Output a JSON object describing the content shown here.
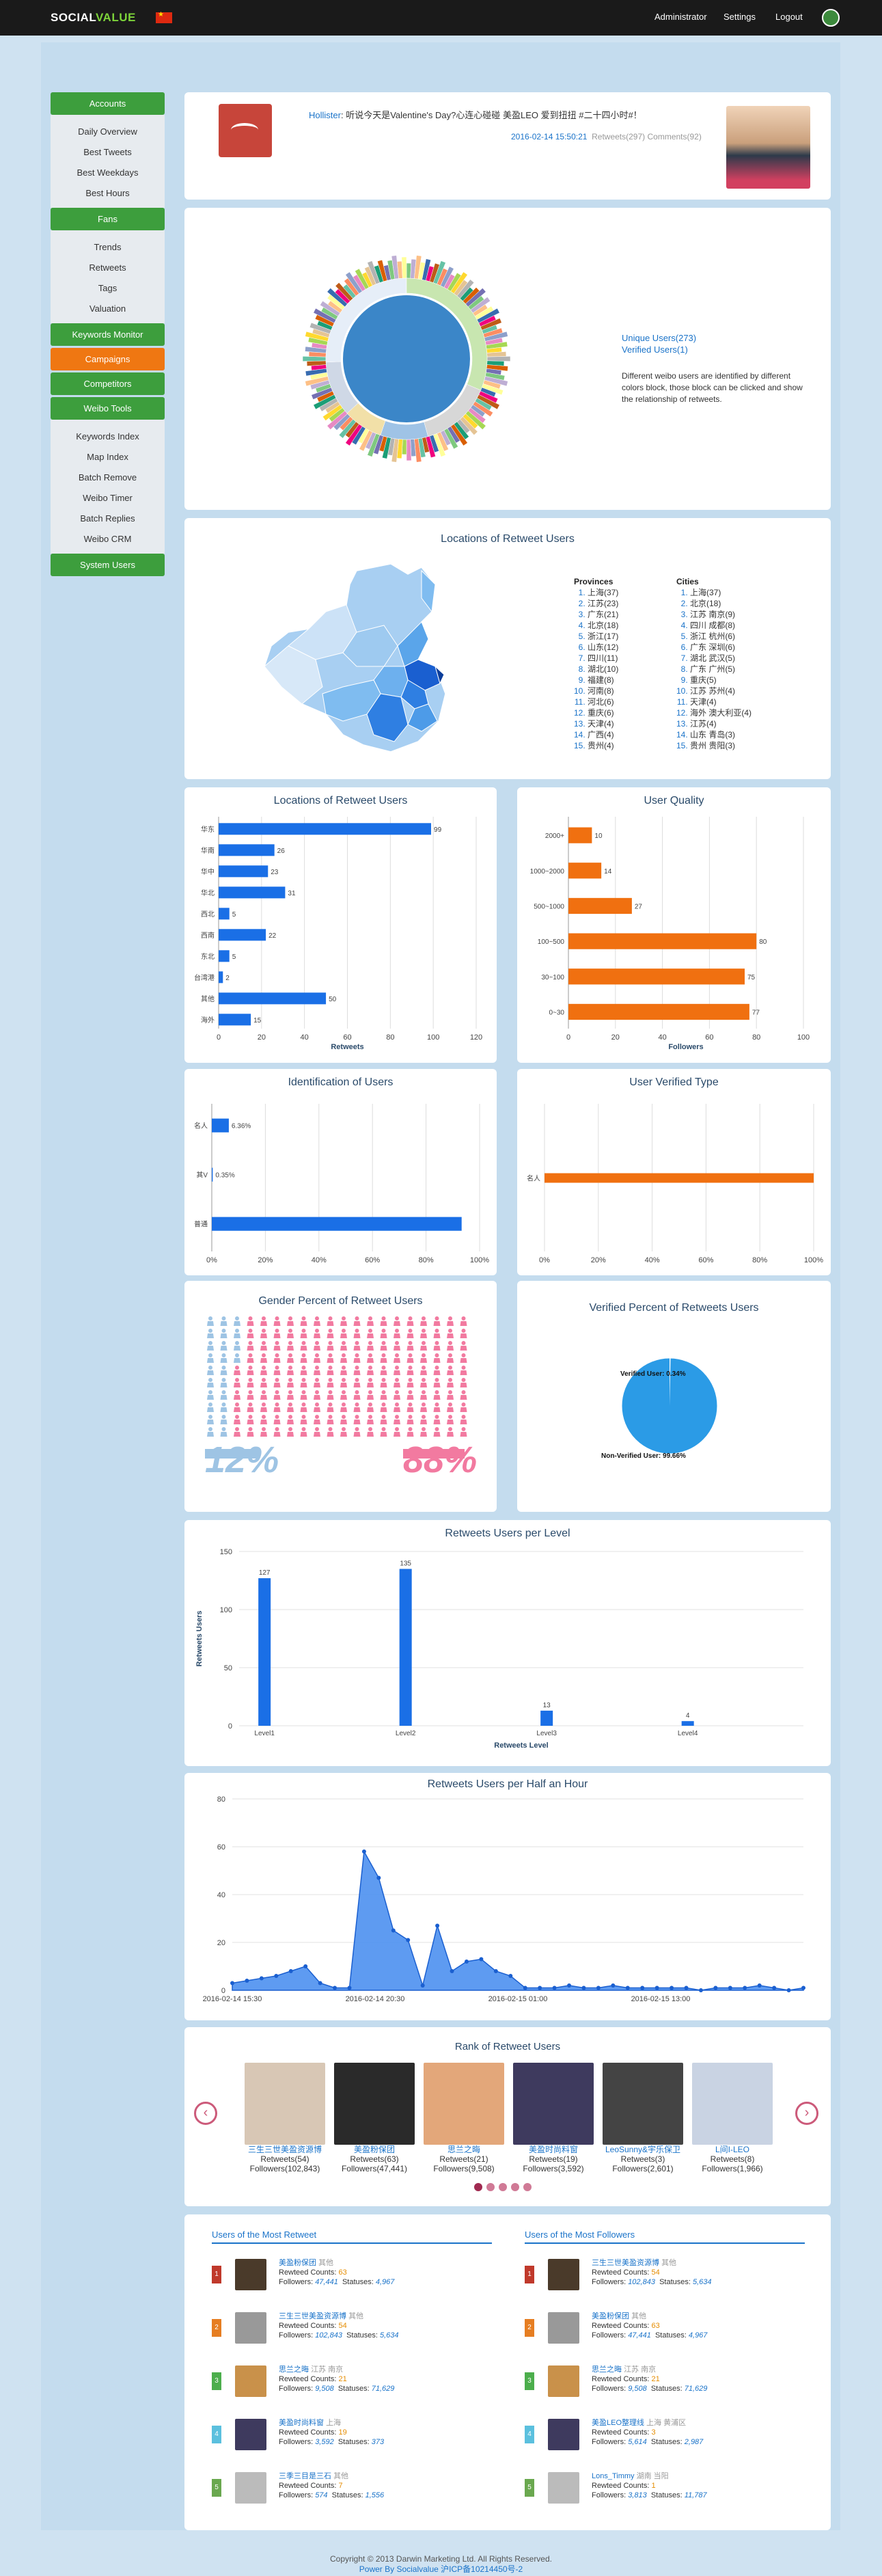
{
  "brand": {
    "left": "SOCIAL",
    "right": "VALUE"
  },
  "topnav": [
    "Administrator",
    "Settings",
    "Logout"
  ],
  "sidebar": {
    "accounts": "Accounts",
    "accounts_items": [
      "Daily Overview",
      "Best Tweets",
      "Best Weekdays",
      "Best Hours"
    ],
    "fans": "Fans",
    "fans_items": [
      "Trends",
      "Retweets",
      "Tags",
      "Valuation"
    ],
    "keywords": "Keywords Monitor",
    "campaigns": "Campaigns",
    "competitors": "Competitors",
    "weibo": "Weibo Tools",
    "weibo_items": [
      "Keywords Index",
      "Map Index",
      "Batch Remove",
      "Weibo Timer",
      "Batch Replies",
      "Weibo CRM"
    ],
    "system": "System Users"
  },
  "tweet": {
    "author": "Hollister",
    "text": ": 听说今天是Valentine's Day?心连心碰碰 美盈LEO 爱到扭扭 #二十四小时#！",
    "time": "2016-02-14 15:50:21",
    "retweets": "Retweets(297)",
    "comments": "Comments(92)"
  },
  "network": {
    "unique": "Unique Users(273)",
    "verified": "Verified Users(1)",
    "desc": "Different weibo users are identified by different colors block, those block can be clicked and show the relationship of retweets."
  },
  "map": {
    "title": "Locations of Retweet Users",
    "prov_h": "Provinces",
    "city_h": "Cities",
    "provinces": [
      "上海(37)",
      "江苏(23)",
      "广东(21)",
      "北京(18)",
      "浙江(17)",
      "山东(12)",
      "四川(11)",
      "湖北(10)",
      "福建(8)",
      "河南(8)",
      "河北(6)",
      "重庆(6)",
      "天津(4)",
      "广西(4)",
      "贵州(4)"
    ],
    "cities": [
      "上海(37)",
      "北京(18)",
      "江苏 南京(9)",
      "四川 成都(8)",
      "浙江 杭州(6)",
      "广东 深圳(6)",
      "湖北 武汉(5)",
      "广东 广州(5)",
      "重庆(5)",
      "江苏 苏州(4)",
      "天津(4)",
      "海外 澳大利亚(4)",
      "江苏(4)",
      "山东 青岛(3)",
      "贵州 贵阳(3)"
    ]
  },
  "loc_chart": {
    "title": "Locations of Retweet Users",
    "xlabel": "Retweets"
  },
  "quality_chart": {
    "title": "User Quality",
    "xlabel": "Followers"
  },
  "ident_chart": {
    "title": "Identification of Users"
  },
  "vtype_chart": {
    "title": "User Verified Type"
  },
  "gender": {
    "title": "Gender Percent of Retweet Users",
    "male": "12%",
    "female": "88%"
  },
  "verified_pct": {
    "title": "Verified Percent of Retweets Users"
  },
  "level_chart": {
    "title": "Retweets Users per Level",
    "xlabel": "Retweets Level",
    "ylabel": "Retweets Users"
  },
  "half_chart": {
    "title": "Retweets Users per Half an Hour",
    "ylabel": "Retweets Users"
  },
  "rank": {
    "title": "Rank of Retweet Users",
    "prev": "‹",
    "next": "›",
    "users": [
      {
        "name": "三生三世美盈资源博",
        "r": "Retweets(54)",
        "f": "Followers(102,843)"
      },
      {
        "name": "美盈粉保团",
        "r": "Retweets(63)",
        "f": "Followers(47,441)"
      },
      {
        "name": "思兰之晦",
        "r": "Retweets(21)",
        "f": "Followers(9,508)"
      },
      {
        "name": "美盈时尚料窗",
        "r": "Retweets(19)",
        "f": "Followers(3,592)"
      },
      {
        "name": "LeoSunny&宇乐保卫",
        "r": "Retweets(3)",
        "f": "Followers(2,601)"
      },
      {
        "name": "L间I-LEO",
        "r": "Retweets(8)",
        "f": "Followers(1,966)"
      }
    ]
  },
  "most_retweet": {
    "title": "Users of the Most Retweet",
    "rows": [
      {
        "rank": "1",
        "name": "美盈粉保团",
        "loc": "其他",
        "rc": "63",
        "fol": "47,441",
        "st": "4,967"
      },
      {
        "rank": "2",
        "name": "三生三世美盈资源博",
        "loc": "其他",
        "rc": "54",
        "fol": "102,843",
        "st": "5,634"
      },
      {
        "rank": "3",
        "name": "思兰之晦",
        "loc": "江苏 南京",
        "rc": "21",
        "fol": "9,508",
        "st": "71,629"
      },
      {
        "rank": "4",
        "name": "美盈时尚料窗",
        "loc": "上海",
        "rc": "19",
        "fol": "3,592",
        "st": "373"
      },
      {
        "rank": "5",
        "name": "三季三目是三石",
        "loc": "其他",
        "rc": "7",
        "fol": "574",
        "st": "1,556"
      }
    ]
  },
  "most_followers": {
    "title": "Users of the Most Followers",
    "rows": [
      {
        "rank": "1",
        "name": "三生三世美盈资源博",
        "loc": "其他",
        "rc": "54",
        "fol": "102,843",
        "st": "5,634"
      },
      {
        "rank": "2",
        "name": "美盈粉保团",
        "loc": "其他",
        "rc": "63",
        "fol": "47,441",
        "st": "4,967"
      },
      {
        "rank": "3",
        "name": "思兰之晦",
        "loc": "江苏 南京",
        "rc": "21",
        "fol": "9,508",
        "st": "71,629"
      },
      {
        "rank": "4",
        "name": "美盈LEO整理线",
        "loc": "上海 黄浦区",
        "rc": "3",
        "fol": "5,614",
        "st": "2,987"
      },
      {
        "rank": "5",
        "name": "Lons_Timmy",
        "loc": "湖南 当阳",
        "rc": "1",
        "fol": "3,813",
        "st": "11,787"
      }
    ]
  },
  "labels": {
    "rc": "Rewteed Counts:",
    "fol": "Followers:",
    "st": "Statuses:"
  },
  "footer": {
    "line1": "Copyright © 2013 Darwin Marketing Ltd. All Rights Reserved.",
    "line2": "Power By Socialvalue 沪ICP备10214450号-2"
  },
  "chart_data": [
    {
      "type": "bar",
      "title": "Locations of Retweet Users",
      "xlabel": "Retweets",
      "categories": [
        "华东",
        "华南",
        "华中",
        "华北",
        "西北",
        "西南",
        "东北",
        "台湾港",
        "其他",
        "海外"
      ],
      "values": [
        99,
        26,
        23,
        31,
        5,
        22,
        5,
        2,
        50,
        15
      ],
      "xlim": [
        0,
        120
      ],
      "color": "#1a6fe6"
    },
    {
      "type": "bar",
      "title": "User Quality",
      "xlabel": "Followers",
      "categories": [
        "2000+",
        "1000~2000",
        "500~1000",
        "100~500",
        "30~100",
        "0~30"
      ],
      "values": [
        10,
        14,
        27,
        80,
        75,
        77
      ],
      "xlim": [
        0,
        100
      ],
      "color": "#f07010"
    },
    {
      "type": "bar",
      "title": "Identification of Users",
      "categories": [
        "名人",
        "其V",
        "普通"
      ],
      "values": [
        6.36,
        0.35,
        93.29
      ],
      "labels": [
        "6.36%",
        "0.35%",
        ""
      ],
      "xlim": [
        0,
        100
      ],
      "unit": "%",
      "color": "#1a6fe6"
    },
    {
      "type": "bar",
      "title": "User Verified Type",
      "categories": [
        "名人"
      ],
      "values": [
        100
      ],
      "xlim": [
        0,
        100
      ],
      "unit": "%",
      "color": "#f07010"
    },
    {
      "type": "pie",
      "title": "Verified Percent of Retweets Users",
      "labels": [
        "Verified User",
        "Non-Verified User"
      ],
      "values": [
        0.34,
        99.66
      ],
      "display": [
        "Verified User: 0.34%",
        "Non-Verified User: 99.66%"
      ]
    },
    {
      "type": "bar",
      "title": "Retweets Users per Level",
      "categories": [
        "Level1",
        "Level2",
        "Level3",
        "Level4"
      ],
      "values": [
        127,
        135,
        13,
        4
      ],
      "ylim": [
        0,
        150
      ],
      "yticks": [
        0,
        50,
        100,
        150
      ],
      "xlabel": "Retweets Level",
      "ylabel": "Retweets Users"
    },
    {
      "type": "area",
      "title": "Retweets Users per Half an Hour",
      "xticks": [
        "2016-02-14 15:30",
        "2016-02-14 20:30",
        "2016-02-15 01:00",
        "2016-02-15 13:00"
      ],
      "ylim": [
        0,
        80
      ],
      "yticks": [
        0,
        20,
        40,
        60,
        80
      ],
      "values": [
        3,
        4,
        5,
        6,
        8,
        10,
        3,
        1,
        1,
        58,
        47,
        25,
        21,
        2,
        27,
        8,
        12,
        13,
        8,
        6,
        1,
        1,
        1,
        2,
        1,
        1,
        2,
        1,
        1,
        1,
        1,
        1,
        0,
        1,
        1,
        1,
        2,
        1,
        0,
        1
      ]
    }
  ]
}
